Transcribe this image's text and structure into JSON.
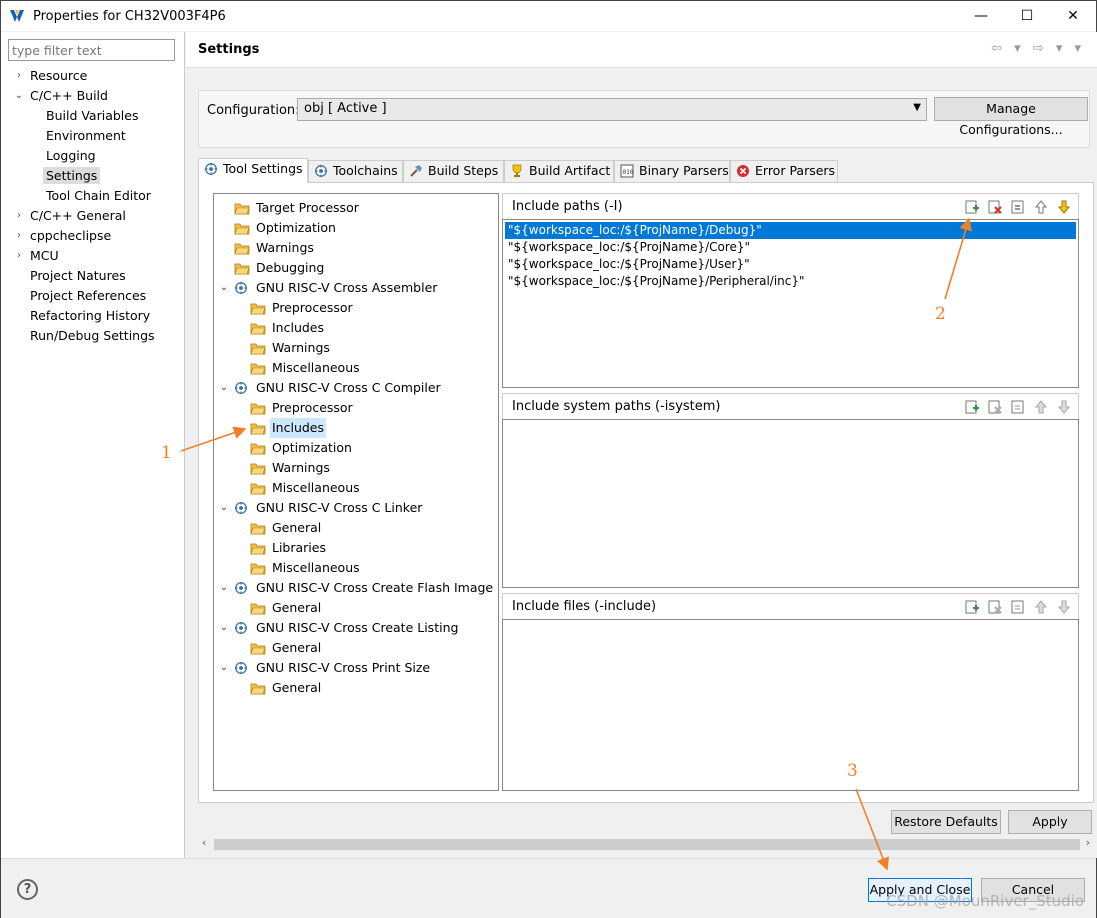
{
  "window": {
    "title": "Properties for CH32V003F4P6",
    "minimize": "—",
    "maximize": "☐",
    "close": "✕"
  },
  "filter": {
    "placeholder": "type filter text"
  },
  "nav": [
    {
      "label": "Resource",
      "arrow": "›"
    },
    {
      "label": "C/C++ Build",
      "arrow": "⌄"
    },
    {
      "label": "Build Variables"
    },
    {
      "label": "Environment"
    },
    {
      "label": "Logging"
    },
    {
      "label": "Settings",
      "selected": true
    },
    {
      "label": "Tool Chain Editor"
    },
    {
      "label": "C/C++ General",
      "arrow": "›"
    },
    {
      "label": "cppcheclipse",
      "arrow": "›"
    },
    {
      "label": "MCU",
      "arrow": "›"
    },
    {
      "label": "Project Natures"
    },
    {
      "label": "Project References"
    },
    {
      "label": "Refactoring History"
    },
    {
      "label": "Run/Debug Settings"
    }
  ],
  "header": {
    "title": "Settings",
    "nav_buttons": "⇦ ▾ ⇨ ▾ ▾"
  },
  "config": {
    "label": "Configuration:",
    "value": "obj  [ Active ]",
    "manage": "Manage Configurations..."
  },
  "tabs": [
    {
      "label": "Tool Settings",
      "icon": "gear-icon",
      "active": true
    },
    {
      "label": "Toolchains",
      "icon": "gear-icon"
    },
    {
      "label": "Build Steps",
      "icon": "hammer-icon"
    },
    {
      "label": "Build Artifact",
      "icon": "trophy-icon"
    },
    {
      "label": "Binary Parsers",
      "icon": "binary-icon"
    },
    {
      "label": "Error Parsers",
      "icon": "error-icon"
    }
  ],
  "tree": [
    {
      "label": "Target Processor",
      "level": 1,
      "icon": "folder"
    },
    {
      "label": "Optimization",
      "level": 1,
      "icon": "folder"
    },
    {
      "label": "Warnings",
      "level": 1,
      "icon": "folder"
    },
    {
      "label": "Debugging",
      "level": 1,
      "icon": "folder"
    },
    {
      "label": "GNU RISC-V Cross Assembler",
      "level": 1,
      "icon": "gear",
      "expand": "⌄"
    },
    {
      "label": "Preprocessor",
      "level": 2,
      "icon": "folder"
    },
    {
      "label": "Includes",
      "level": 2,
      "icon": "folder"
    },
    {
      "label": "Warnings",
      "level": 2,
      "icon": "folder"
    },
    {
      "label": "Miscellaneous",
      "level": 2,
      "icon": "folder"
    },
    {
      "label": "GNU RISC-V Cross C Compiler",
      "level": 1,
      "icon": "gear",
      "expand": "⌄"
    },
    {
      "label": "Preprocessor",
      "level": 2,
      "icon": "folder"
    },
    {
      "label": "Includes",
      "level": 2,
      "icon": "folder",
      "selected": true
    },
    {
      "label": "Optimization",
      "level": 2,
      "icon": "folder"
    },
    {
      "label": "Warnings",
      "level": 2,
      "icon": "folder"
    },
    {
      "label": "Miscellaneous",
      "level": 2,
      "icon": "folder"
    },
    {
      "label": "GNU RISC-V Cross C Linker",
      "level": 1,
      "icon": "gear",
      "expand": "⌄"
    },
    {
      "label": "General",
      "level": 2,
      "icon": "folder"
    },
    {
      "label": "Libraries",
      "level": 2,
      "icon": "folder"
    },
    {
      "label": "Miscellaneous",
      "level": 2,
      "icon": "folder"
    },
    {
      "label": "GNU RISC-V Cross Create Flash Image",
      "level": 1,
      "icon": "gear",
      "expand": "⌄"
    },
    {
      "label": "General",
      "level": 2,
      "icon": "folder"
    },
    {
      "label": "GNU RISC-V Cross Create Listing",
      "level": 1,
      "icon": "gear",
      "expand": "⌄"
    },
    {
      "label": "General",
      "level": 2,
      "icon": "folder"
    },
    {
      "label": "GNU RISC-V Cross Print Size",
      "level": 1,
      "icon": "gear",
      "expand": "⌄"
    },
    {
      "label": "General",
      "level": 2,
      "icon": "folder"
    }
  ],
  "sections": [
    {
      "title": "Include paths (-I)",
      "items": [
        "\"${workspace_loc:/${ProjName}/Debug}\"",
        "\"${workspace_loc:/${ProjName}/Core}\"",
        "\"${workspace_loc:/${ProjName}/User}\"",
        "\"${workspace_loc:/${ProjName}/Peripheral/inc}\""
      ]
    },
    {
      "title": "Include system paths (-isystem)",
      "items": []
    },
    {
      "title": "Include files (-include)",
      "items": []
    }
  ],
  "buttons": {
    "restore": "Restore Defaults",
    "apply": "Apply",
    "apply_close": "Apply and Close",
    "cancel": "Cancel",
    "help": "?"
  },
  "annotations": {
    "a1": "1",
    "a2": "2",
    "a3": "3",
    "color": "#f07f2b"
  },
  "watermark": "CSDN @MounRiver_Studio"
}
